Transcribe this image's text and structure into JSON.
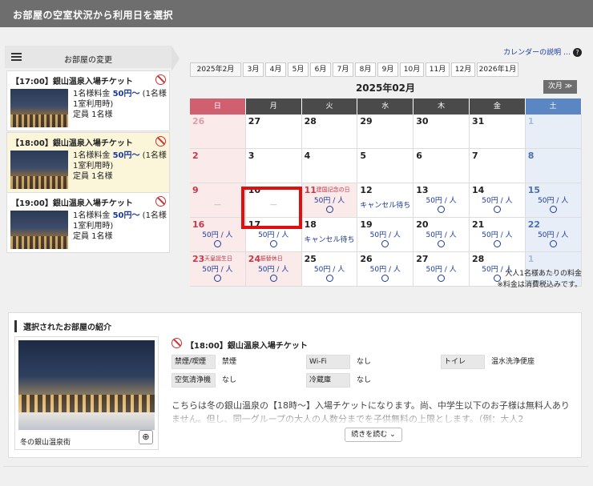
{
  "header": {
    "title": "お部屋の空室状況から利用日を選択"
  },
  "rooms": {
    "heading": "お部屋の変更",
    "items": [
      {
        "title": "【17:00】銀山温泉入場チケット",
        "line1": "1名様料金",
        "price": "50円〜",
        "line1b": "(1名様",
        "line2": "1室利用時)",
        "capacity": "定員 1名様"
      },
      {
        "title": "【18:00】銀山温泉入場チケット",
        "line1": "1名様料金",
        "price": "50円〜",
        "line1b": "(1名様",
        "line2": "1室利用時)",
        "capacity": "定員 1名様"
      },
      {
        "title": "【19:00】銀山温泉入場チケット",
        "line1": "1名様料金",
        "price": "50円〜",
        "line1b": "(1名様",
        "line2": "1室利用時)",
        "capacity": "定員 1名様"
      }
    ]
  },
  "calendar": {
    "help_link": "カレンダーの説明 …",
    "help_icon": "?",
    "months": [
      "2025年2月",
      "3月",
      "4月",
      "5月",
      "6月",
      "7月",
      "8月",
      "9月",
      "10月",
      "11月",
      "12月",
      "2026年1月"
    ],
    "title": "2025年02月",
    "next": "次月",
    "weekdays": [
      "日",
      "月",
      "火",
      "水",
      "木",
      "金",
      "土"
    ],
    "weeks": [
      [
        {
          "d": "26",
          "f": 1,
          "t": "none"
        },
        {
          "d": "27",
          "t": "none"
        },
        {
          "d": "28",
          "t": "none"
        },
        {
          "d": "29",
          "t": "none"
        },
        {
          "d": "30",
          "t": "none"
        },
        {
          "d": "31",
          "t": "none"
        },
        {
          "d": "1",
          "f": 1,
          "t": "none"
        }
      ],
      [
        {
          "d": "2",
          "t": "none"
        },
        {
          "d": "3",
          "t": "none"
        },
        {
          "d": "4",
          "t": "none"
        },
        {
          "d": "5",
          "t": "none"
        },
        {
          "d": "6",
          "t": "none"
        },
        {
          "d": "7",
          "t": "none"
        },
        {
          "d": "8",
          "t": "none"
        }
      ],
      [
        {
          "d": "9",
          "t": "dash",
          "dash": "—"
        },
        {
          "d": "10",
          "t": "dash",
          "dash": "—"
        },
        {
          "d": "11",
          "t": "price",
          "holiday": "建国記念の日",
          "p": "50円 / 人"
        },
        {
          "d": "12",
          "t": "wait",
          "w": "キャンセル待ち"
        },
        {
          "d": "13",
          "t": "price",
          "p": "50円 / 人"
        },
        {
          "d": "14",
          "t": "price",
          "p": "50円 / 人"
        },
        {
          "d": "15",
          "t": "price",
          "p": "50円 / 人"
        }
      ],
      [
        {
          "d": "16",
          "t": "price",
          "p": "50円 / 人"
        },
        {
          "d": "17",
          "t": "price",
          "p": "50円 / 人"
        },
        {
          "d": "18",
          "t": "wait",
          "w": "キャンセル待ち"
        },
        {
          "d": "19",
          "t": "price",
          "p": "50円 / 人"
        },
        {
          "d": "20",
          "t": "price",
          "p": "50円 / 人"
        },
        {
          "d": "21",
          "t": "price",
          "p": "50円 / 人"
        },
        {
          "d": "22",
          "t": "price",
          "p": "50円 / 人"
        }
      ],
      [
        {
          "d": "23",
          "t": "price",
          "holiday": "天皇誕生日",
          "p": "50円 / 人"
        },
        {
          "d": "24",
          "t": "price",
          "holiday": "振替休日",
          "p": "50円 / 人"
        },
        {
          "d": "25",
          "t": "price",
          "p": "50円 / 人"
        },
        {
          "d": "26",
          "t": "price",
          "p": "50円 / 人"
        },
        {
          "d": "27",
          "t": "price",
          "p": "50円 / 人"
        },
        {
          "d": "28",
          "t": "price",
          "p": "50円 / 人"
        },
        {
          "d": "1",
          "f": 1,
          "t": "dash",
          "dash": "—"
        }
      ]
    ],
    "note1": "大人1名様あたりの料金",
    "note2": "※料金は消費税込みです。"
  },
  "intro": {
    "heading": "選択されたお部屋の紹介",
    "photo_caption": "冬の銀山温泉街",
    "title": "【18:00】銀山温泉入場チケット",
    "specs": [
      [
        {
          "label": "禁煙/喫煙",
          "value": "禁煙"
        },
        {
          "label": "Wi-Fi",
          "value": "なし"
        },
        {
          "label": "トイレ",
          "value": "温水洗浄便座"
        }
      ],
      [
        {
          "label": "空気清浄機",
          "value": "なし"
        },
        {
          "label": "冷蔵庫",
          "value": "なし"
        }
      ]
    ],
    "description": "こちらは冬の銀山温泉の【18時〜】入場チケットになります。尚、中学生以下のお子様は無料人ありません。但し、同一グループの大人の人数分までを子供無料の上限とします。（例：大人2",
    "read_more": "続きを読む"
  }
}
